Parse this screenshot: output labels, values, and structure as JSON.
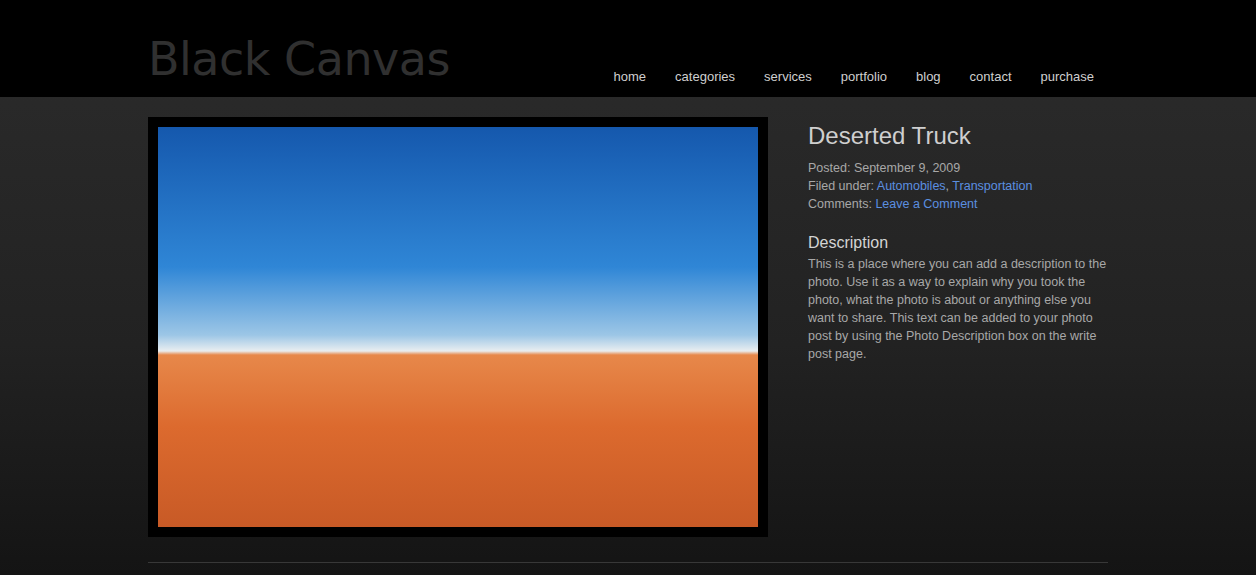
{
  "site": {
    "logo": "Black Canvas"
  },
  "nav": [
    "home",
    "categories",
    "services",
    "portfolio",
    "blog",
    "contact",
    "purchase"
  ],
  "post": {
    "title": "Deserted Truck",
    "posted_label": "Posted:",
    "posted": "September 9, 2009",
    "filed_label": "Filed under:",
    "categories": [
      "Automobiles",
      "Transportation"
    ],
    "category_separator": ",",
    "comments_label": "Comments:",
    "comments_link": "Leave a Comment",
    "description_title": "Description",
    "description": "This is a place where you can add a description to the photo. Use it as a way to explain why you took the photo, what the photo is about or anything else you want to share. This text can be added to your photo post by using the Photo Description box on the write post page."
  }
}
